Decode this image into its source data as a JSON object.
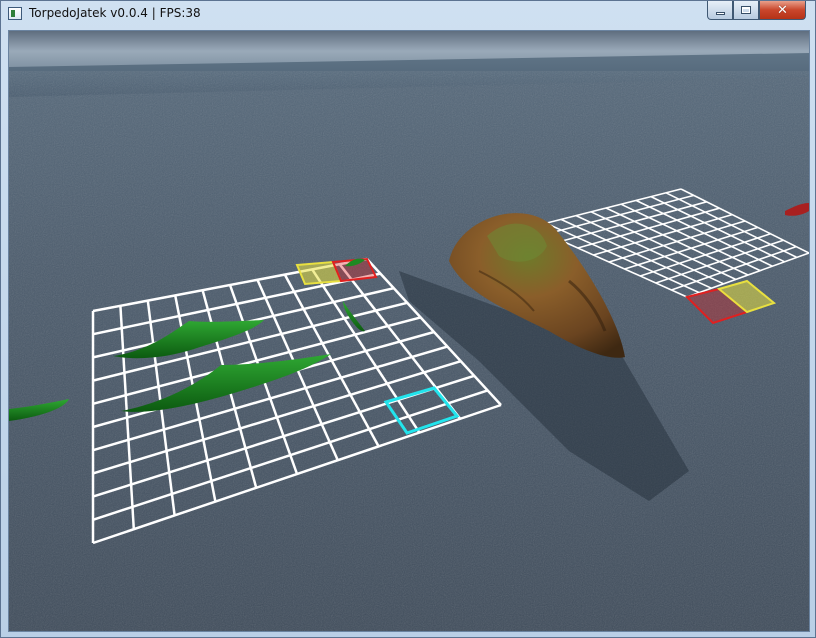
{
  "window": {
    "title": "TorpedoJatek v0.0.4  | FPS:38",
    "buttons": {
      "minimize": "minimize",
      "maximize": "maximize",
      "close": "✕"
    }
  },
  "scene": {
    "grids": [
      {
        "name": "player-grid",
        "rows": 10,
        "cols": 10
      },
      {
        "name": "enemy-grid",
        "rows": 10,
        "cols": 10
      }
    ],
    "colors": {
      "sky": "#8a9caf",
      "water": "#4a5a6c",
      "grid_line": "#ffffff",
      "ship": "#1e8a22",
      "marker_yellow": "#e8e040",
      "marker_red": "#e02020",
      "cursor": "#22e4ec",
      "island": "#8a5a2a"
    },
    "icons": [
      "ship-icon",
      "island-icon",
      "cursor-icon"
    ]
  }
}
